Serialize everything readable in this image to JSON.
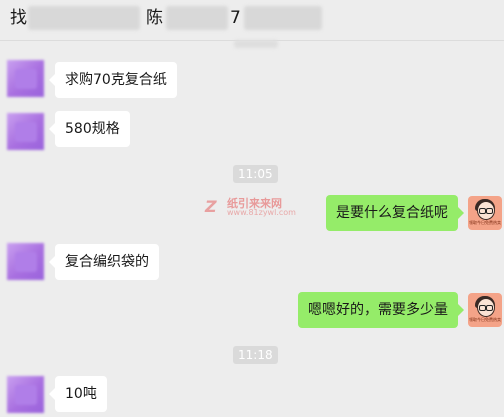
{
  "header": {
    "title_start": "找",
    "title_middle": "陈",
    "title_end": "7"
  },
  "messages": [
    {
      "text": "求购70克复合纸"
    },
    {
      "text": "580规格"
    },
    {
      "text": "是要什么复合纸呢"
    },
    {
      "text": "复合编织袋的"
    },
    {
      "text": "嗯嗯好的，需要多少量"
    },
    {
      "text": "10吨"
    }
  ],
  "times": [
    "11:05",
    "11:18"
  ],
  "watermark": {
    "name": "纸引来来网",
    "url": "www.81zywl.com"
  },
  "avatar_right_caption": "领取今日免费热卖",
  "colors": {
    "background": "#ededed",
    "bubble_self": "#95ec69",
    "bubble_other": "#ffffff",
    "time_label": "#dadada"
  },
  "icons": {
    "avatar_other": "blurred-avatar-icon",
    "avatar_self": "cartoon-girl-avatar-icon",
    "watermark": "watermark-logo-icon"
  }
}
